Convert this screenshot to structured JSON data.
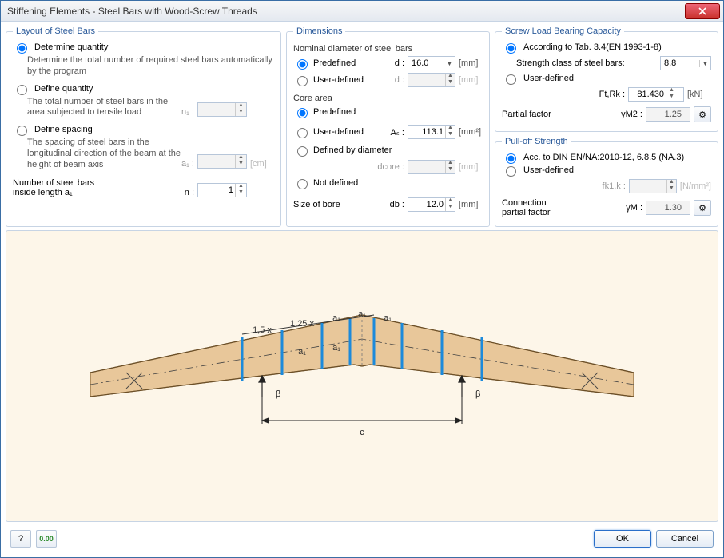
{
  "window": {
    "title": "Stiffening Elements - Steel Bars with Wood-Screw Threads"
  },
  "layout": {
    "legend": "Layout of Steel Bars",
    "opt1": {
      "label": "Determine quantity",
      "desc": "Determine the total number of required steel bars automatically by the program"
    },
    "opt2": {
      "label": "Define quantity",
      "desc": "The total number of steel bars in the area subjected to tensile load",
      "param": "n₁ :"
    },
    "opt3": {
      "label": "Define spacing",
      "desc": "The spacing of steel bars in the longitudinal direction of the beam at the height of beam axis",
      "param": "a₁ :",
      "unit": "[cm]"
    },
    "num_label1": "Number of steel bars",
    "num_label2": "inside length a₁",
    "n_param": "n :",
    "n_value": "1"
  },
  "dims": {
    "legend": "Dimensions",
    "nominal": "Nominal diameter of steel bars",
    "predefined": "Predefined",
    "userdef": "User-defined",
    "d_label": "d :",
    "d_value": "16.0",
    "d_unit": "[mm]",
    "core_legend": "Core area",
    "as_label": "Aₛ :",
    "as_value": "113.1",
    "as_unit": "[mm²]",
    "def_by_dia": "Defined by diameter",
    "dcore_label": "dcore :",
    "dcore_unit": "[mm]",
    "not_def": "Not defined",
    "bore_label": "Size of bore",
    "db_label": "db :",
    "db_value": "12.0",
    "db_unit": "[mm]"
  },
  "screw": {
    "legend": "Screw Load Bearing Capacity",
    "opt_tab": "According to Tab. 3.4(EN 1993-1-8)",
    "strength_label": "Strength class of steel bars:",
    "strength_value": "8.8",
    "userdef": "User-defined",
    "ftrk_label": "Ft,Rk :",
    "ftrk_value": "81.430",
    "ftrk_unit": "[kN]",
    "partial_label": "Partial factor",
    "gamma_m2": "γM2 :",
    "gamma_m2_value": "1.25"
  },
  "pulloff": {
    "legend": "Pull-off Strength",
    "opt_din": "Acc. to DIN EN/NA:2010-12, 6.8.5 (NA.3)",
    "userdef": "User-defined",
    "fk1_label": "fk1,k :",
    "fk1_unit": "[N/mm²]",
    "conn_label1": "Connection",
    "conn_label2": "partial factor",
    "gamma_m": "γM :",
    "gamma_m_value": "1.30"
  },
  "diagram": {
    "a1": "a₁",
    "x15": "1,5 x",
    "x125": "1,25 x",
    "beta": "β",
    "c": "c"
  },
  "footer": {
    "ok": "OK",
    "cancel": "Cancel"
  }
}
